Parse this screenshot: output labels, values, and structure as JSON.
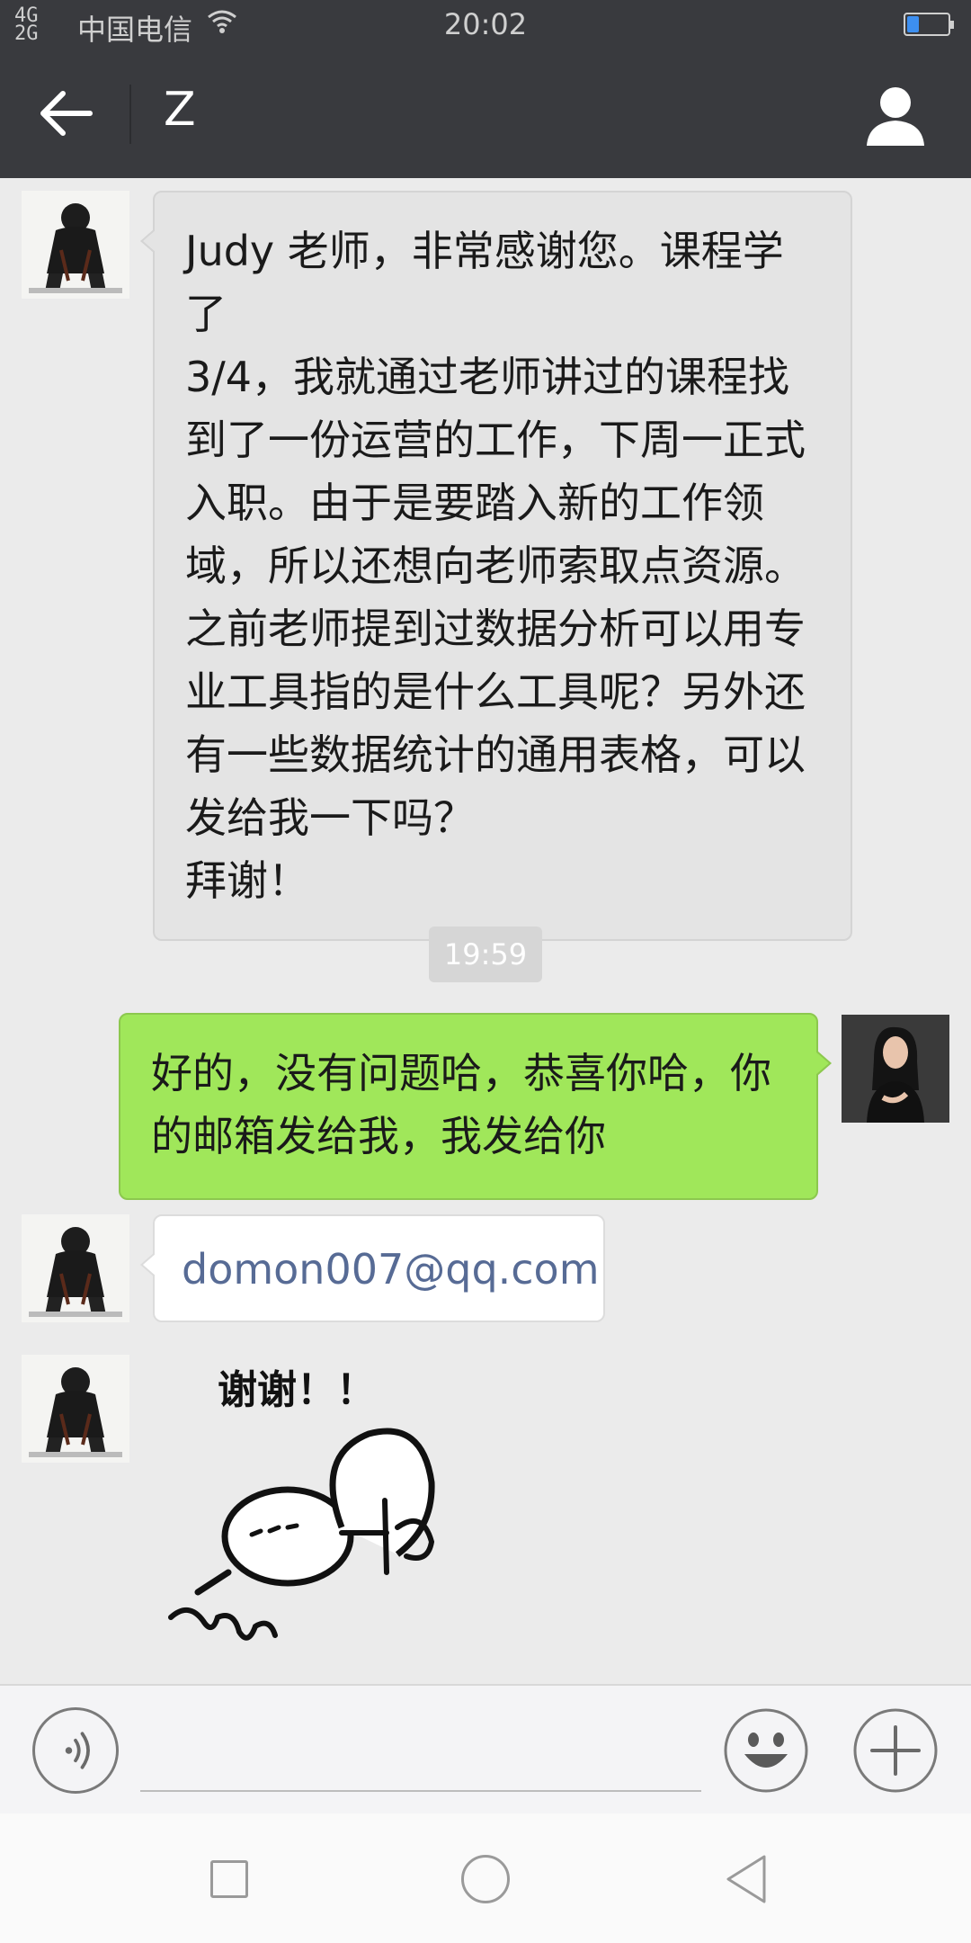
{
  "status_bar": {
    "signal": "4G\n2G",
    "carrier": "中国电信",
    "time": "20:02",
    "battery_level": 0.3
  },
  "header": {
    "title": "Z",
    "back_icon": "arrow-left-icon",
    "profile_icon": "person-icon"
  },
  "messages": [
    {
      "direction": "incoming",
      "text": "Judy 老师，非常感谢您。课程学了\n3/4，我就通过老师讲过的课程找\n到了一份运营的工作，下周一正式\n入职。由于是要踏入新的工作领\n域，所以还想向老师索取点资源。\n之前老师提到过数据分析可以用专\n业工具指的是什么工具呢？另外还\n有一些数据统计的通用表格，可以\n发给我一下吗？\n拜谢！"
    },
    {
      "type": "timestamp",
      "text": "19:59"
    },
    {
      "direction": "outgoing",
      "text": "好的，没有问题哈，恭喜你哈，你的邮箱发给我，我发给你"
    },
    {
      "direction": "incoming",
      "text": "domon007@qq.com"
    },
    {
      "direction": "incoming",
      "type": "sticker",
      "text": "谢谢！！"
    }
  ],
  "input_bar": {
    "voice_icon": "voice-icon",
    "emoji_icon": "emoji-icon",
    "more_icon": "plus-icon"
  },
  "colors": {
    "header_bg": "#393a3e",
    "chat_bg": "#ebebeb",
    "outgoing_bubble": "#a0e75a",
    "incoming_bubble": "#e4e4e4",
    "link": "#576b95"
  }
}
